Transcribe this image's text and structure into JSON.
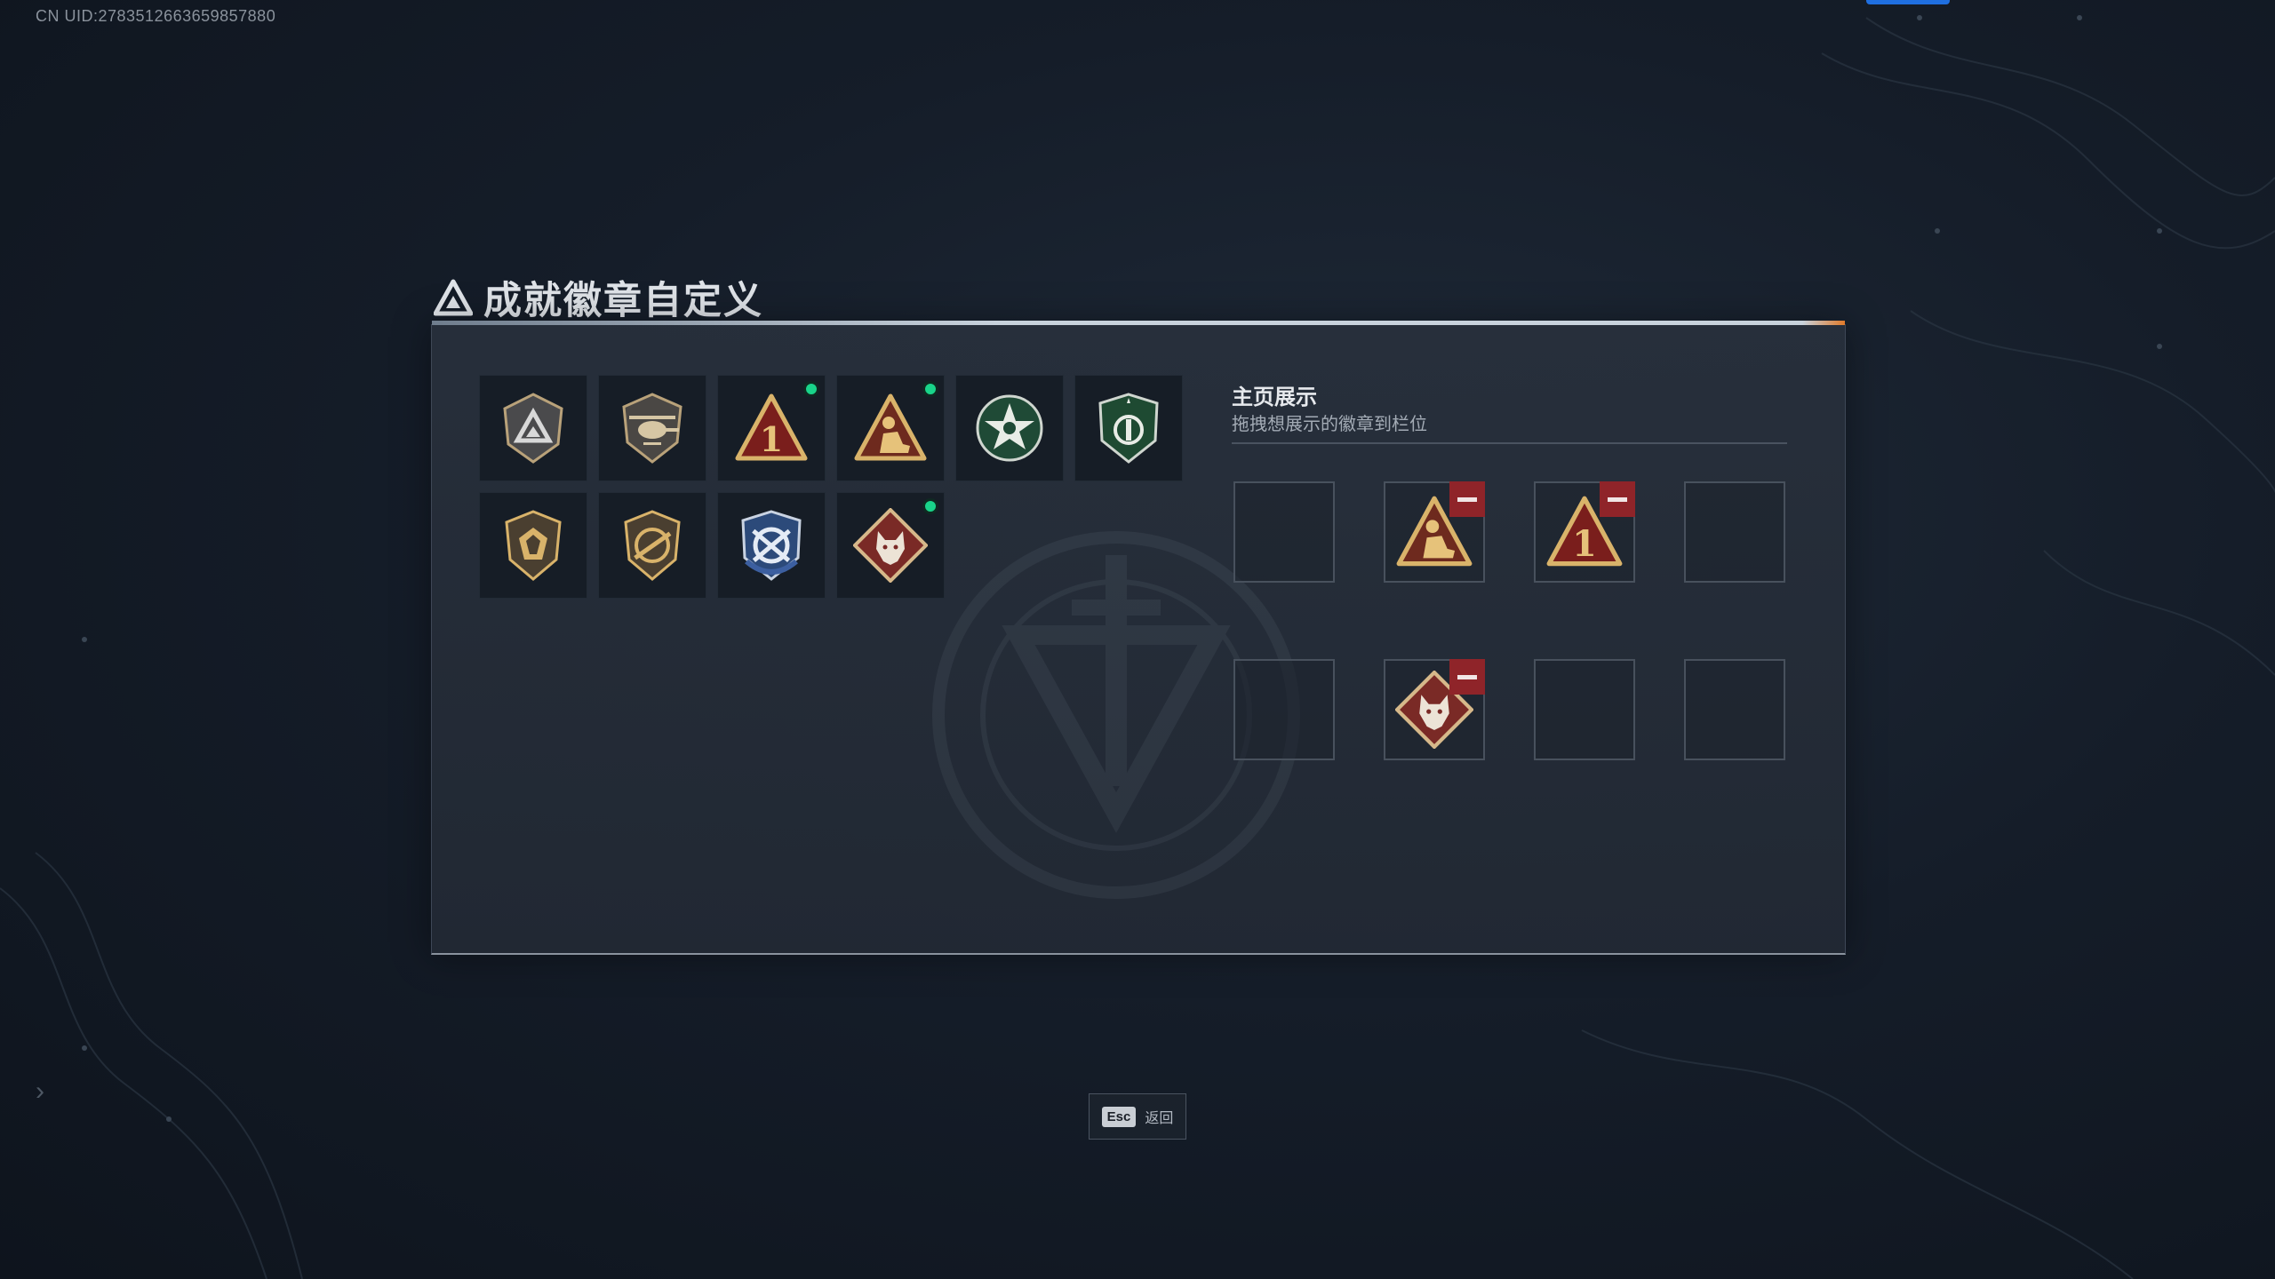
{
  "header": {
    "uid": "CN UID:2783512663659857880"
  },
  "page": {
    "title": "成就徽章自定义"
  },
  "badges": [
    {
      "icon": "gray-triangle-shield-badge-icon",
      "is_new": false
    },
    {
      "icon": "helicopter-shield-badge-icon",
      "is_new": false
    },
    {
      "icon": "gold-number-one-triangle-badge-icon",
      "is_new": true
    },
    {
      "icon": "gold-kneeling-soldier-triangle-badge-icon",
      "is_new": true
    },
    {
      "icon": "green-star-round-badge-icon",
      "is_new": false
    },
    {
      "icon": "green-shield-badge-icon",
      "is_new": false
    },
    {
      "icon": "gold-gem-shield-badge-icon",
      "is_new": false
    },
    {
      "icon": "gold-rifle-shield-badge-icon",
      "is_new": false
    },
    {
      "icon": "blue-crossed-weapons-badge-icon",
      "is_new": false
    },
    {
      "icon": "red-wolf-diamond-badge-icon",
      "is_new": true
    }
  ],
  "showcase": {
    "title": "主页展示",
    "subtitle": "拖拽想展示的徽章到栏位",
    "slots": [
      {
        "icon": null
      },
      {
        "icon": "gold-kneeling-soldier-triangle-badge-icon"
      },
      {
        "icon": "gold-number-one-triangle-badge-icon"
      },
      {
        "icon": null
      },
      {
        "icon": null
      },
      {
        "icon": "red-wolf-diamond-badge-icon"
      },
      {
        "icon": null
      },
      {
        "icon": null
      }
    ]
  },
  "footer": {
    "esc_key": "Esc",
    "esc_label": "返回"
  },
  "colors": {
    "new_dot": "#19d48a",
    "remove_button": "#8f2429",
    "accent_orange": "#e07a2a",
    "top_tab_blue": "#1f6fe0"
  }
}
